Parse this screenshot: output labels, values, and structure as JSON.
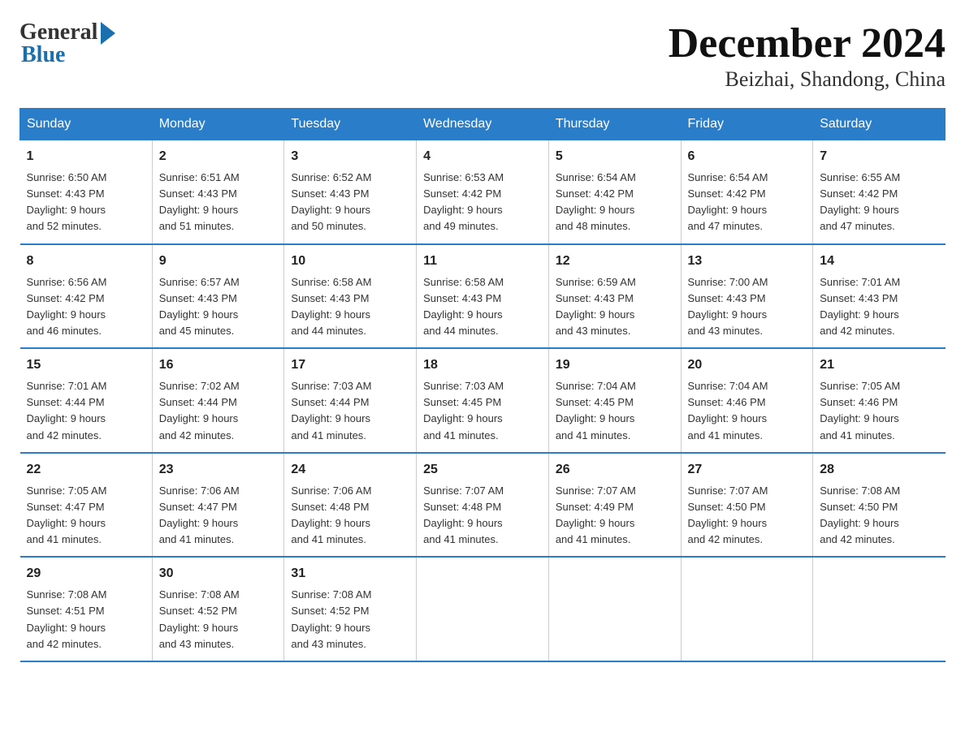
{
  "logo": {
    "general": "General",
    "blue": "Blue"
  },
  "title": {
    "month": "December 2024",
    "location": "Beizhai, Shandong, China"
  },
  "days_header": [
    "Sunday",
    "Monday",
    "Tuesday",
    "Wednesday",
    "Thursday",
    "Friday",
    "Saturday"
  ],
  "weeks": [
    [
      {
        "day": "1",
        "sunrise": "6:50 AM",
        "sunset": "4:43 PM",
        "daylight": "9 hours and 52 minutes."
      },
      {
        "day": "2",
        "sunrise": "6:51 AM",
        "sunset": "4:43 PM",
        "daylight": "9 hours and 51 minutes."
      },
      {
        "day": "3",
        "sunrise": "6:52 AM",
        "sunset": "4:43 PM",
        "daylight": "9 hours and 50 minutes."
      },
      {
        "day": "4",
        "sunrise": "6:53 AM",
        "sunset": "4:42 PM",
        "daylight": "9 hours and 49 minutes."
      },
      {
        "day": "5",
        "sunrise": "6:54 AM",
        "sunset": "4:42 PM",
        "daylight": "9 hours and 48 minutes."
      },
      {
        "day": "6",
        "sunrise": "6:54 AM",
        "sunset": "4:42 PM",
        "daylight": "9 hours and 47 minutes."
      },
      {
        "day": "7",
        "sunrise": "6:55 AM",
        "sunset": "4:42 PM",
        "daylight": "9 hours and 47 minutes."
      }
    ],
    [
      {
        "day": "8",
        "sunrise": "6:56 AM",
        "sunset": "4:42 PM",
        "daylight": "9 hours and 46 minutes."
      },
      {
        "day": "9",
        "sunrise": "6:57 AM",
        "sunset": "4:43 PM",
        "daylight": "9 hours and 45 minutes."
      },
      {
        "day": "10",
        "sunrise": "6:58 AM",
        "sunset": "4:43 PM",
        "daylight": "9 hours and 44 minutes."
      },
      {
        "day": "11",
        "sunrise": "6:58 AM",
        "sunset": "4:43 PM",
        "daylight": "9 hours and 44 minutes."
      },
      {
        "day": "12",
        "sunrise": "6:59 AM",
        "sunset": "4:43 PM",
        "daylight": "9 hours and 43 minutes."
      },
      {
        "day": "13",
        "sunrise": "7:00 AM",
        "sunset": "4:43 PM",
        "daylight": "9 hours and 43 minutes."
      },
      {
        "day": "14",
        "sunrise": "7:01 AM",
        "sunset": "4:43 PM",
        "daylight": "9 hours and 42 minutes."
      }
    ],
    [
      {
        "day": "15",
        "sunrise": "7:01 AM",
        "sunset": "4:44 PM",
        "daylight": "9 hours and 42 minutes."
      },
      {
        "day": "16",
        "sunrise": "7:02 AM",
        "sunset": "4:44 PM",
        "daylight": "9 hours and 42 minutes."
      },
      {
        "day": "17",
        "sunrise": "7:03 AM",
        "sunset": "4:44 PM",
        "daylight": "9 hours and 41 minutes."
      },
      {
        "day": "18",
        "sunrise": "7:03 AM",
        "sunset": "4:45 PM",
        "daylight": "9 hours and 41 minutes."
      },
      {
        "day": "19",
        "sunrise": "7:04 AM",
        "sunset": "4:45 PM",
        "daylight": "9 hours and 41 minutes."
      },
      {
        "day": "20",
        "sunrise": "7:04 AM",
        "sunset": "4:46 PM",
        "daylight": "9 hours and 41 minutes."
      },
      {
        "day": "21",
        "sunrise": "7:05 AM",
        "sunset": "4:46 PM",
        "daylight": "9 hours and 41 minutes."
      }
    ],
    [
      {
        "day": "22",
        "sunrise": "7:05 AM",
        "sunset": "4:47 PM",
        "daylight": "9 hours and 41 minutes."
      },
      {
        "day": "23",
        "sunrise": "7:06 AM",
        "sunset": "4:47 PM",
        "daylight": "9 hours and 41 minutes."
      },
      {
        "day": "24",
        "sunrise": "7:06 AM",
        "sunset": "4:48 PM",
        "daylight": "9 hours and 41 minutes."
      },
      {
        "day": "25",
        "sunrise": "7:07 AM",
        "sunset": "4:48 PM",
        "daylight": "9 hours and 41 minutes."
      },
      {
        "day": "26",
        "sunrise": "7:07 AM",
        "sunset": "4:49 PM",
        "daylight": "9 hours and 41 minutes."
      },
      {
        "day": "27",
        "sunrise": "7:07 AM",
        "sunset": "4:50 PM",
        "daylight": "9 hours and 42 minutes."
      },
      {
        "day": "28",
        "sunrise": "7:08 AM",
        "sunset": "4:50 PM",
        "daylight": "9 hours and 42 minutes."
      }
    ],
    [
      {
        "day": "29",
        "sunrise": "7:08 AM",
        "sunset": "4:51 PM",
        "daylight": "9 hours and 42 minutes."
      },
      {
        "day": "30",
        "sunrise": "7:08 AM",
        "sunset": "4:52 PM",
        "daylight": "9 hours and 43 minutes."
      },
      {
        "day": "31",
        "sunrise": "7:08 AM",
        "sunset": "4:52 PM",
        "daylight": "9 hours and 43 minutes."
      },
      null,
      null,
      null,
      null
    ]
  ],
  "labels": {
    "sunrise": "Sunrise:",
    "sunset": "Sunset:",
    "daylight": "Daylight:"
  }
}
